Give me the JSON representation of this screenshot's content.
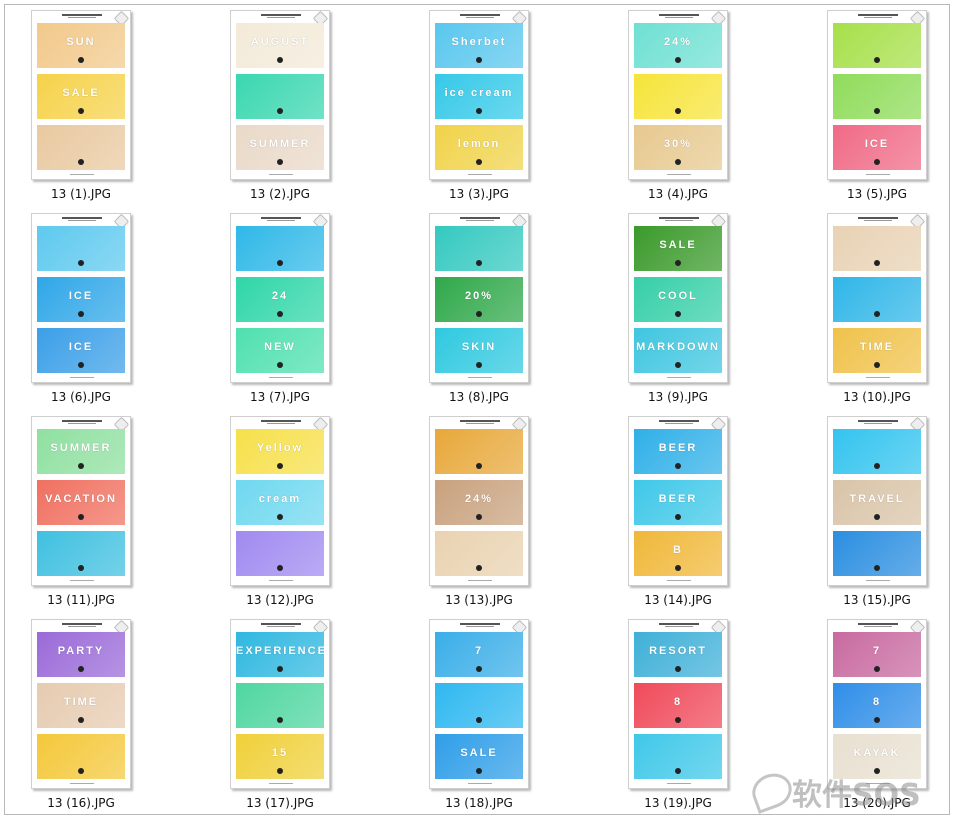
{
  "files": [
    {
      "name": "13 (1).JPG",
      "colors": [
        "#f2c98a",
        "#f6d24a",
        "#e9c9a0"
      ],
      "texts": [
        "SUN",
        "SALE",
        ""
      ]
    },
    {
      "name": "13 (2).JPG",
      "colors": [
        "#f3ead8",
        "#3ad7b0",
        "#e9d9c8"
      ],
      "texts": [
        "AUGUST",
        "",
        "SUMMER"
      ]
    },
    {
      "name": "13 (3).JPG",
      "colors": [
        "#59c7ee",
        "#35c9e8",
        "#f0d34a"
      ],
      "texts": [
        "Sherbet",
        "ice cream",
        "lemon"
      ]
    },
    {
      "name": "13 (4).JPG",
      "colors": [
        "#6fe0d3",
        "#f6e43a",
        "#e7c98f"
      ],
      "texts": [
        "24%",
        "",
        "30%"
      ]
    },
    {
      "name": "13 (5).JPG",
      "colors": [
        "#a6e04a",
        "#8fdc5a",
        "#f06a86"
      ],
      "texts": [
        "",
        "",
        "ICE"
      ]
    },
    {
      "name": "13 (6).JPG",
      "colors": [
        "#5ec9ef",
        "#2fa7e8",
        "#3b9fe8"
      ],
      "texts": [
        "",
        "ICE",
        "ICE"
      ]
    },
    {
      "name": "13 (7).JPG",
      "colors": [
        "#2fb8e8",
        "#2fd6a8",
        "#4fe0b0"
      ],
      "texts": [
        "",
        "24",
        "NEW"
      ]
    },
    {
      "name": "13 (8).JPG",
      "colors": [
        "#34c9c0",
        "#2fa84a",
        "#2fc9e0"
      ],
      "texts": [
        "",
        "20%",
        "SKIN"
      ]
    },
    {
      "name": "13 (9).JPG",
      "colors": [
        "#3a9a2a",
        "#36cfa8",
        "#3fc6e0"
      ],
      "texts": [
        "SALE",
        "COOL",
        "MARKDOWN"
      ]
    },
    {
      "name": "13 (10).JPG",
      "colors": [
        "#e8d2b4",
        "#2fb6e8",
        "#f0c24a"
      ],
      "texts": [
        "",
        "",
        "TIME"
      ]
    },
    {
      "name": "13 (11).JPG",
      "colors": [
        "#8fe0a0",
        "#f07060",
        "#3fc0e0"
      ],
      "texts": [
        "SUMMER",
        "VACATION",
        ""
      ]
    },
    {
      "name": "13 (12).JPG",
      "colors": [
        "#f6e04a",
        "#6fd8ef",
        "#a08af0"
      ],
      "texts": [
        "Yellow",
        "cream",
        ""
      ]
    },
    {
      "name": "13 (13).JPG",
      "colors": [
        "#e8a83a",
        "#c9a27e",
        "#e9d2b0"
      ],
      "texts": [
        "",
        "24%",
        ""
      ]
    },
    {
      "name": "13 (14).JPG",
      "colors": [
        "#2fb0e8",
        "#3fc8e8",
        "#f0b83a"
      ],
      "texts": [
        "BEER",
        "BEER",
        "B"
      ]
    },
    {
      "name": "13 (15).JPG",
      "colors": [
        "#33c4ef",
        "#d9c4a8",
        "#2a8ee0"
      ],
      "texts": [
        "",
        "TRAVEL",
        ""
      ]
    },
    {
      "name": "13 (16).JPG",
      "colors": [
        "#9a6ad8",
        "#e6cbb0",
        "#f4c83a"
      ],
      "texts": [
        "PARTY",
        "TIME",
        ""
      ]
    },
    {
      "name": "13 (17).JPG",
      "colors": [
        "#2fb8e0",
        "#4fd6a0",
        "#f0d03a"
      ],
      "texts": [
        "EXPERIENCE",
        "",
        "15"
      ]
    },
    {
      "name": "13 (18).JPG",
      "colors": [
        "#3aaee8",
        "#2fb8f0",
        "#2f9ee8"
      ],
      "texts": [
        "7",
        "",
        "SALE"
      ]
    },
    {
      "name": "13 (19).JPG",
      "colors": [
        "#3fb0d8",
        "#f04a5a",
        "#3fc8e8"
      ],
      "texts": [
        "RESORT",
        "8",
        ""
      ]
    },
    {
      "name": "13 (20).JPG",
      "colors": [
        "#c86aa0",
        "#2f8ee8",
        "#e8e0d0"
      ],
      "texts": [
        "7",
        "8",
        "KAYAK"
      ]
    }
  ],
  "watermark": "软件SOS"
}
